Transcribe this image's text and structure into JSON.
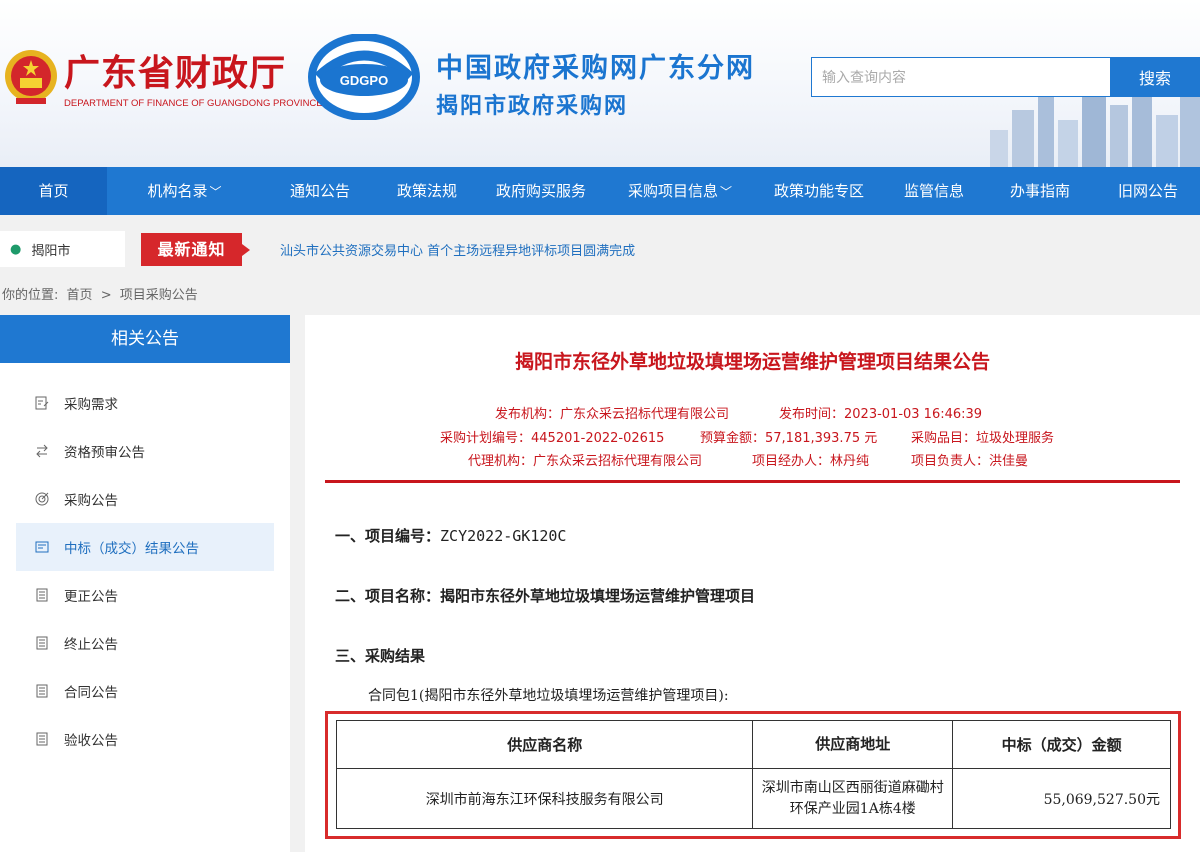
{
  "header": {
    "finance_title": "广东省财政厅",
    "finance_subtitle": "DEPARTMENT OF FINANCE OF GUANGDONG PROVINCE",
    "logo_text": "GDGPO",
    "portal_title": "中国政府采购网广东分网",
    "portal_subtitle": "揭阳市政府采购网",
    "search_placeholder": "输入查询内容",
    "search_button": "搜索"
  },
  "nav": [
    {
      "label": "首页",
      "dropdown": false,
      "active": true
    },
    {
      "label": "机构名录",
      "dropdown": true,
      "active": false
    },
    {
      "label": "通知公告",
      "dropdown": false,
      "active": false
    },
    {
      "label": "政策法规",
      "dropdown": false,
      "active": false
    },
    {
      "label": "政府购买服务",
      "dropdown": false,
      "active": false
    },
    {
      "label": "采购项目信息",
      "dropdown": true,
      "active": false
    },
    {
      "label": "政策功能专区",
      "dropdown": false,
      "active": false
    },
    {
      "label": "监管信息",
      "dropdown": false,
      "active": false
    },
    {
      "label": "办事指南",
      "dropdown": false,
      "active": false
    },
    {
      "label": "旧网公告",
      "dropdown": false,
      "active": false
    }
  ],
  "notice": {
    "location": "揭阳市",
    "badge": "最新通知",
    "text": "汕头市公共资源交易中心 首个主场远程异地评标项目圆满完成"
  },
  "breadcrumb": {
    "prefix": "你的位置:",
    "home": "首页",
    "separator": ">",
    "current": "项目采购公告"
  },
  "sidebar": {
    "title": "相关公告",
    "items": [
      {
        "label": "采购需求",
        "icon": "document-edit-icon",
        "active": false
      },
      {
        "label": "资格预审公告",
        "icon": "swap-arrows-icon",
        "active": false
      },
      {
        "label": "采购公告",
        "icon": "target-icon",
        "active": false
      },
      {
        "label": "中标（成交）结果公告",
        "icon": "document-stack-icon",
        "active": true
      },
      {
        "label": "更正公告",
        "icon": "document-lines-icon",
        "active": false
      },
      {
        "label": "终止公告",
        "icon": "document-lines-icon",
        "active": false
      },
      {
        "label": "合同公告",
        "icon": "document-lines-icon",
        "active": false
      },
      {
        "label": "验收公告",
        "icon": "document-lines-icon",
        "active": false
      }
    ]
  },
  "article": {
    "title": "揭阳市东径外草地垃圾填埋场运营维护管理项目结果公告",
    "meta": {
      "publisher": "发布机构：广东众采云招标代理有限公司",
      "publish_time": "发布时间：2023-01-03 16:46:39",
      "plan_no": "采购计划编号：445201-2022-02615",
      "budget": "预算金额：57,181,393.75 元",
      "category": "采购品目：垃圾处理服务",
      "agency": "代理机构：广东众采云招标代理有限公司",
      "handler": "项目经办人：林丹纯",
      "manager": "项目负责人：洪佳曼"
    },
    "section1_label": "一、项目编号：",
    "section1_value": "ZCY2022-GK120C",
    "section2": "二、项目名称：揭阳市东径外草地垃圾填埋场运营维护管理项目",
    "section3": "三、采购结果",
    "package": "合同包1(揭阳市东径外草地垃圾填埋场运营维护管理项目):",
    "table": {
      "headers": [
        "供应商名称",
        "供应商地址",
        "中标（成交）金额"
      ],
      "rows": [
        [
          "深圳市前海东江环保科技服务有限公司",
          "深圳市南山区西丽街道麻磡村环保产业园1A栋4楼",
          "55,069,527.50元"
        ]
      ]
    }
  },
  "colors": {
    "primary_blue": "#1f78d1",
    "title_red": "#c8161d",
    "highlight_red": "#d82b2b"
  }
}
